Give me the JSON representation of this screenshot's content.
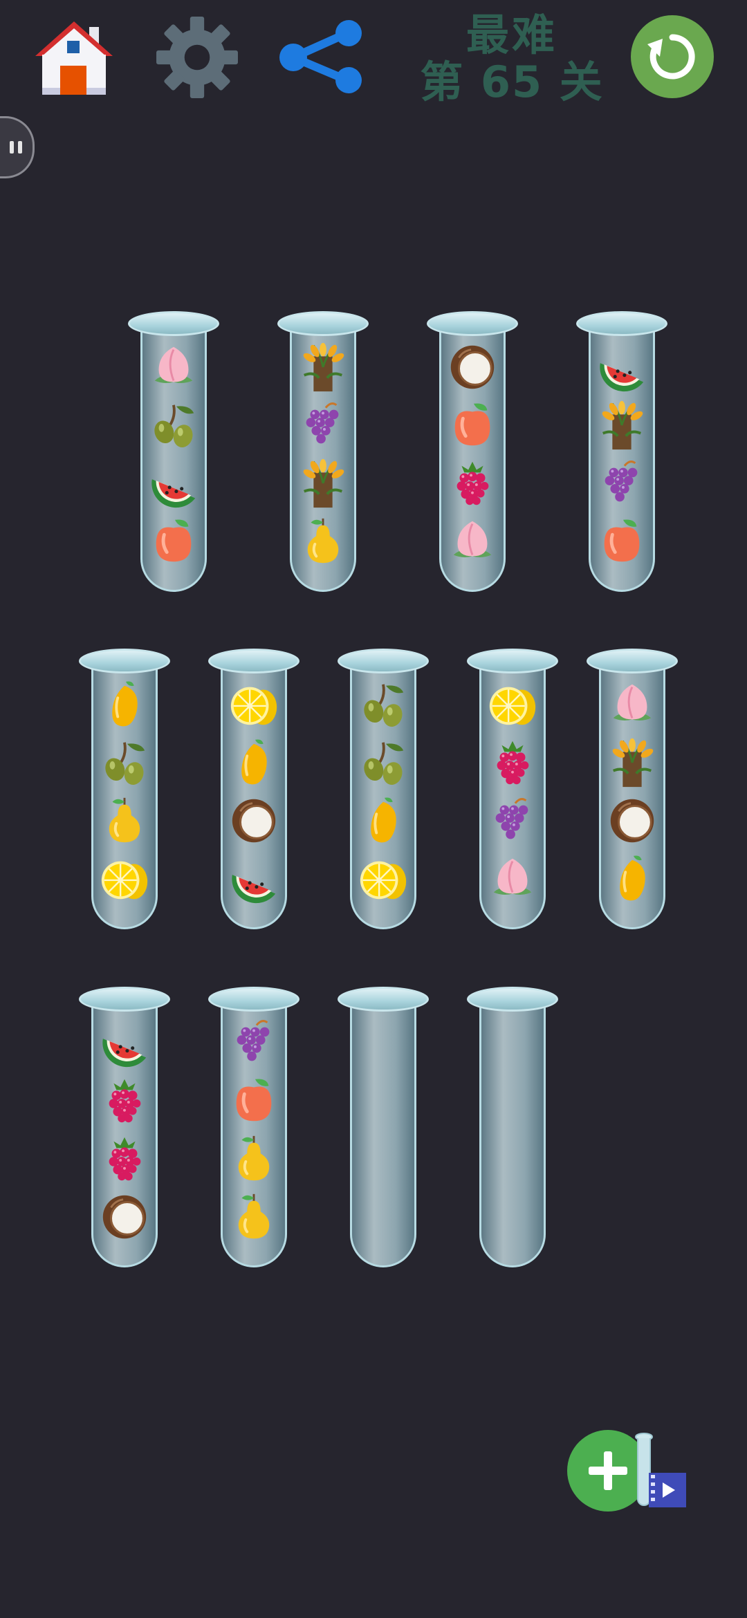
{
  "header": {
    "difficulty": "最难",
    "level_label": "第 65 关",
    "home_icon": "house-icon",
    "settings_icon": "gear-icon",
    "share_icon": "share-icon",
    "restart_icon": "restart-icon",
    "restart_color": "#6aa84f"
  },
  "side": {
    "pause_icon": "pause-icon"
  },
  "board": {
    "capacity": 4,
    "rows": [
      [
        {
          "fruits": [
            "peach",
            "olive",
            "watermelon",
            "apple"
          ]
        },
        {
          "fruits": [
            "wheat",
            "grape",
            "wheat",
            "pear"
          ]
        },
        {
          "fruits": [
            "coconut",
            "apple",
            "raspberry",
            "peach"
          ]
        },
        {
          "fruits": [
            "watermelon",
            "wheat",
            "grape",
            "apple"
          ]
        }
      ],
      [
        {
          "fruits": [
            "mango",
            "olive",
            "pear",
            "lemon"
          ]
        },
        {
          "fruits": [
            "lemon",
            "mango",
            "coconut",
            "watermelon"
          ]
        },
        {
          "fruits": [
            "olive",
            "olive",
            "mango",
            "lemon"
          ]
        },
        {
          "fruits": [
            "lemon",
            "raspberry",
            "grape",
            "peach"
          ]
        },
        {
          "fruits": [
            "peach",
            "wheat",
            "coconut",
            "mango"
          ]
        }
      ],
      [
        {
          "fruits": [
            "watermelon",
            "raspberry",
            "raspberry",
            "coconut"
          ]
        },
        {
          "fruits": [
            "grape",
            "apple",
            "pear",
            "pear"
          ]
        },
        {
          "fruits": []
        },
        {
          "fruits": []
        }
      ]
    ]
  },
  "footer": {
    "add_tube_icon": "plus-icon",
    "video_icon": "video-play-icon",
    "add_tube_color": "#4caf50"
  }
}
